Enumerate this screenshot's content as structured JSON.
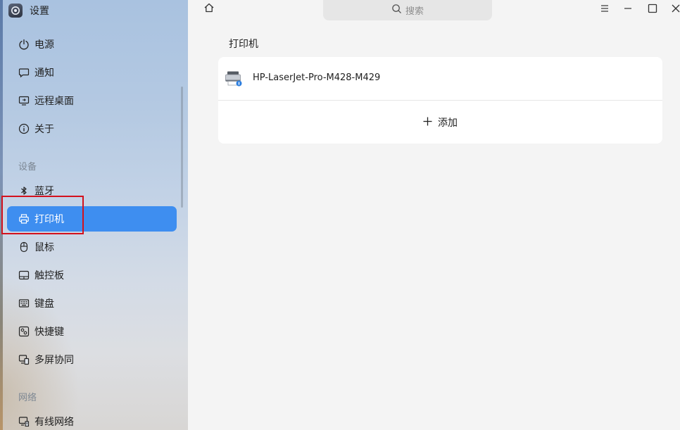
{
  "app": {
    "title": "设置",
    "logo_icon": "settings-app-icon"
  },
  "sidebar": {
    "items_top": [
      {
        "label": "电源",
        "icon": "power-icon"
      },
      {
        "label": "通知",
        "icon": "notification-icon"
      },
      {
        "label": "远程桌面",
        "icon": "remote-desktop-icon"
      },
      {
        "label": "关于",
        "icon": "info-icon"
      }
    ],
    "sections": [
      {
        "title": "设备",
        "items": [
          {
            "label": "蓝牙",
            "icon": "bluetooth-icon"
          },
          {
            "label": "打印机",
            "icon": "printer-icon",
            "active": true
          },
          {
            "label": "鼠标",
            "icon": "mouse-icon"
          },
          {
            "label": "触控板",
            "icon": "touchpad-icon"
          },
          {
            "label": "键盘",
            "icon": "keyboard-icon"
          },
          {
            "label": "快捷键",
            "icon": "shortcut-icon"
          },
          {
            "label": "多屏协同",
            "icon": "multiscreen-icon"
          }
        ]
      },
      {
        "title": "网络",
        "items": [
          {
            "label": "有线网络",
            "icon": "wired-network-icon"
          }
        ]
      }
    ],
    "active_color": "#3e8ef0",
    "highlight_color": "#d3111d"
  },
  "topbar": {
    "home_icon": "home-icon",
    "search": {
      "placeholder": "搜索",
      "icon": "search-icon"
    },
    "window_controls": [
      "menu-icon",
      "minimize-icon",
      "maximize-icon",
      "close-icon"
    ]
  },
  "main": {
    "title": "打印机",
    "printers": [
      {
        "name": "HP-LaserJet-Pro-M428-M429",
        "icon": "printer-device-icon"
      }
    ],
    "add_label": "添加",
    "add_icon": "plus-icon"
  }
}
